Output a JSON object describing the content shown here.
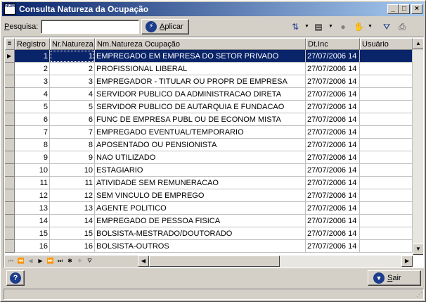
{
  "window": {
    "icon_text": "NOM",
    "title": "Consulta Natureza da Ocupação",
    "minimize_glyph": "_",
    "maximize_glyph": "□",
    "close_glyph": "×"
  },
  "toolbar": {
    "search_label_accel": "P",
    "search_label_rest": "esquisa:",
    "search_value": "",
    "apply_accel": "A",
    "apply_rest": "plicar"
  },
  "grid": {
    "headers": [
      "Registro",
      "Nr.Natureza",
      "Nm.Natureza Ocupação",
      "Dt.Inc",
      "Usuário"
    ],
    "rows": [
      [
        "1",
        "1",
        "EMPREGADO EM EMPRESA DO SETOR PRIVADO",
        "27/07/2006 14",
        ""
      ],
      [
        "2",
        "2",
        "PROFISSIONAL LIBERAL",
        "27/07/2006 14",
        ""
      ],
      [
        "3",
        "3",
        "EMPREGADOR - TITULAR OU PROPR DE EMPRESA",
        "27/07/2006 14",
        ""
      ],
      [
        "4",
        "4",
        "SERVIDOR PUBLICO DA ADMINISTRACAO DIRETA",
        "27/07/2006 14",
        ""
      ],
      [
        "5",
        "5",
        "SERVIDOR PUBLICO DE AUTARQUIA E FUNDACAO",
        "27/07/2006 14",
        ""
      ],
      [
        "6",
        "6",
        "FUNC DE EMPRESA PUBL OU DE ECONOM MISTA",
        "27/07/2006 14",
        ""
      ],
      [
        "7",
        "7",
        "EMPREGADO EVENTUAL/TEMPORARIO",
        "27/07/2006 14",
        ""
      ],
      [
        "8",
        "8",
        "APOSENTADO OU PENSIONISTA",
        "27/07/2006 14",
        ""
      ],
      [
        "9",
        "9",
        "NAO UTILIZADO",
        "27/07/2006 14",
        ""
      ],
      [
        "10",
        "10",
        "ESTAGIARIO",
        "27/07/2006 14",
        ""
      ],
      [
        "11",
        "11",
        "ATIVIDADE SEM REMUNERACAO",
        "27/07/2006 14",
        ""
      ],
      [
        "12",
        "12",
        "SEM VINCULO DE EMPREGO",
        "27/07/2006 14",
        ""
      ],
      [
        "13",
        "13",
        "AGENTE POLITICO",
        "27/07/2006 14",
        ""
      ],
      [
        "14",
        "14",
        "EMPREGADO DE PESSOA FISICA",
        "27/07/2006 14",
        ""
      ],
      [
        "15",
        "15",
        "BOLSISTA-MESTRADO/DOUTORADO",
        "27/07/2006 14",
        ""
      ],
      [
        "16",
        "16",
        "BOLSISTA-OUTROS",
        "27/07/2006 14",
        ""
      ]
    ]
  },
  "footer": {
    "help_glyph": "?",
    "exit_accel": "S",
    "exit_rest": "air"
  },
  "colors": {
    "selection": "#0a246a",
    "face": "#d4d0c8",
    "title_start": "#0a246a",
    "title_end": "#a6caf0"
  }
}
